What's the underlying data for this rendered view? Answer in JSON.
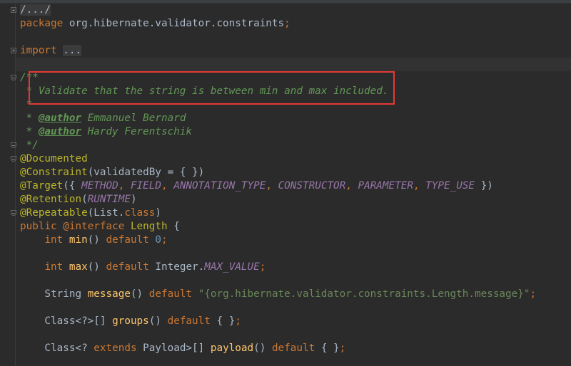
{
  "editor": {
    "lines": [
      [
        {
          "t": "/.../",
          "c": "fold"
        }
      ],
      [
        {
          "t": "package",
          "c": "kw"
        },
        {
          "t": " org.hibernate.validator.constraints"
        },
        {
          "t": ";",
          "c": "kw"
        }
      ],
      [],
      [
        {
          "t": "import",
          "c": "kw"
        },
        {
          "t": " "
        },
        {
          "t": "...",
          "c": "fold"
        }
      ],
      [],
      [
        {
          "t": "/**",
          "c": "cm"
        }
      ],
      [
        {
          "t": " * Validate that the string is between min and max included.",
          "c": "cm"
        }
      ],
      [
        {
          "t": " *",
          "c": "cm"
        }
      ],
      [
        {
          "t": " * ",
          "c": "cm"
        },
        {
          "t": "@author",
          "c": "tag"
        },
        {
          "t": " Emmanuel Bernard",
          "c": "cm"
        }
      ],
      [
        {
          "t": " * ",
          "c": "cm"
        },
        {
          "t": "@author",
          "c": "tag"
        },
        {
          "t": " Hardy Ferentschik",
          "c": "cm"
        }
      ],
      [
        {
          "t": " */",
          "c": "cm"
        }
      ],
      [
        {
          "t": "@Documented",
          "c": "an"
        }
      ],
      [
        {
          "t": "@Constraint",
          "c": "an"
        },
        {
          "t": "(validatedBy = { })"
        }
      ],
      [
        {
          "t": "@Target",
          "c": "an"
        },
        {
          "t": "({ "
        },
        {
          "t": "METHOD",
          "c": "cn"
        },
        {
          "t": ", ",
          "c": "kw"
        },
        {
          "t": "FIELD",
          "c": "cn"
        },
        {
          "t": ", ",
          "c": "kw"
        },
        {
          "t": "ANNOTATION_TYPE",
          "c": "cn"
        },
        {
          "t": ", ",
          "c": "kw"
        },
        {
          "t": "CONSTRUCTOR",
          "c": "cn"
        },
        {
          "t": ", ",
          "c": "kw"
        },
        {
          "t": "PARAMETER",
          "c": "cn"
        },
        {
          "t": ", ",
          "c": "kw"
        },
        {
          "t": "TYPE_USE",
          "c": "cn"
        },
        {
          "t": " })"
        }
      ],
      [
        {
          "t": "@Retention",
          "c": "an"
        },
        {
          "t": "("
        },
        {
          "t": "RUNTIME",
          "c": "cn"
        },
        {
          "t": ")"
        }
      ],
      [
        {
          "t": "@Repeatable",
          "c": "an"
        },
        {
          "t": "(List."
        },
        {
          "t": "class",
          "c": "kw"
        },
        {
          "t": ")"
        }
      ],
      [
        {
          "t": "public ",
          "c": "kw"
        },
        {
          "t": "@interface ",
          "c": "kw"
        },
        {
          "t": "Length",
          "c": "an"
        },
        {
          "t": " {"
        }
      ],
      [
        {
          "t": "    "
        },
        {
          "t": "int ",
          "c": "kw"
        },
        {
          "t": "min",
          "c": "fn"
        },
        {
          "t": "() "
        },
        {
          "t": "default ",
          "c": "kw"
        },
        {
          "t": "0",
          "c": "num"
        },
        {
          "t": ";",
          "c": "kw"
        }
      ],
      [],
      [
        {
          "t": "    "
        },
        {
          "t": "int ",
          "c": "kw"
        },
        {
          "t": "max",
          "c": "fn"
        },
        {
          "t": "() "
        },
        {
          "t": "default ",
          "c": "kw"
        },
        {
          "t": "Integer."
        },
        {
          "t": "MAX_VALUE",
          "c": "cn"
        },
        {
          "t": ";",
          "c": "kw"
        }
      ],
      [],
      [
        {
          "t": "    String "
        },
        {
          "t": "message",
          "c": "fn"
        },
        {
          "t": "() "
        },
        {
          "t": "default ",
          "c": "kw"
        },
        {
          "t": "\"{org.hibernate.validator.constraints.Length.message}\"",
          "c": "str"
        },
        {
          "t": ";",
          "c": "kw"
        }
      ],
      [],
      [
        {
          "t": "    Class<?>[] "
        },
        {
          "t": "groups",
          "c": "fn"
        },
        {
          "t": "() "
        },
        {
          "t": "default ",
          "c": "kw"
        },
        {
          "t": "{ }"
        },
        {
          "t": ";",
          "c": "kw"
        }
      ],
      [],
      [
        {
          "t": "    Class<? "
        },
        {
          "t": "extends ",
          "c": "kw"
        },
        {
          "t": "Payload>[] "
        },
        {
          "t": "payload",
          "c": "fn"
        },
        {
          "t": "() "
        },
        {
          "t": "default ",
          "c": "kw"
        },
        {
          "t": "{ }"
        },
        {
          "t": ";",
          "c": "kw"
        }
      ]
    ],
    "fold_markers": [
      {
        "line": 0,
        "state": "collapsed"
      },
      {
        "line": 3,
        "state": "collapsed"
      },
      {
        "line": 5,
        "state": "expanded"
      },
      {
        "line": 10,
        "state": "end"
      },
      {
        "line": 11,
        "state": "expanded"
      },
      {
        "line": 15,
        "state": "end"
      }
    ],
    "highlight_color": "#e53935"
  }
}
